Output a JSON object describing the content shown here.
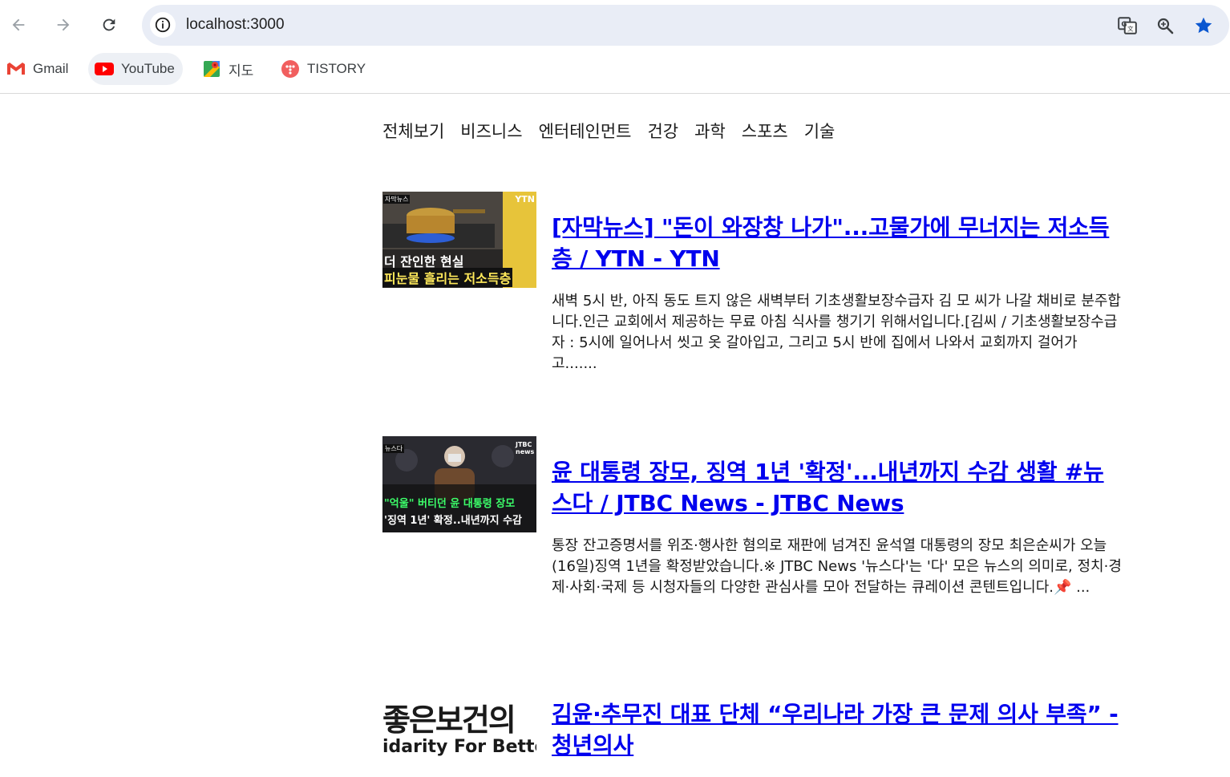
{
  "browser": {
    "url": "localhost:3000",
    "bookmarks": [
      {
        "label": "Gmail"
      },
      {
        "label": "YouTube"
      },
      {
        "label": "지도"
      },
      {
        "label": "TISTORY"
      }
    ]
  },
  "categories": [
    "전체보기",
    "비즈니스",
    "엔터테인먼트",
    "건강",
    "과학",
    "스포츠",
    "기술"
  ],
  "articles": [
    {
      "title": "[자막뉴스] \"돈이 와장창 나가\"...고물가에 무너지는 저소득층 / YTN - YTN",
      "description": "새벽 5시 반, 아직 동도 트지 않은 새벽부터 기초생활보장수급자 김 모 씨가 나갈 채비로 분주합니다.인근 교회에서 제공하는 무료 아침 식사를 챙기기 위해서입니다.[김씨 / 기초생활보장수급자 : 5시에 일어나서 씻고 옷 갈아입고, 그리고 5시 반에 집에서 나와서 교회까지 걸어가고.......",
      "thumb": {
        "tag": "자막뉴스",
        "brand": "YTN",
        "line1": "더 잔인한 현실",
        "line2": "피눈물 흘리는 저소득층"
      }
    },
    {
      "title": "윤 대통령 장모, 징역 1년 '확정'...내년까지 수감 생활 #뉴스다 / JTBC News - JTBC News",
      "description": "통장 잔고증명서를 위조·행사한 혐의로 재판에 넘겨진 윤석열 대통령의 장모 최은순씨가 오늘 (16일)징역 1년을 확정받았습니다.※ JTBC News '뉴스다'는 '다' 모은 뉴스의 의미로, 정치·경제·사회·국제 등 시청자들의 다양한 관심사를 모아 전달하는 큐레이션 콘텐트입니다.📌 ...",
      "thumb": {
        "tag": "뉴스다",
        "brand": "JTBC news",
        "line1": "\"억울\" 버티던 윤 대통령 장모",
        "line2": "'징역 1년' 확정..내년까지 수감"
      }
    },
    {
      "title": "김윤·추무진 대표 단체 “우리나라 가장 큰 문제 의사 부족” - 청년의사",
      "description": "",
      "thumb": {
        "line1": "좋은보건의",
        "line2": "idarity For Bette"
      }
    }
  ]
}
